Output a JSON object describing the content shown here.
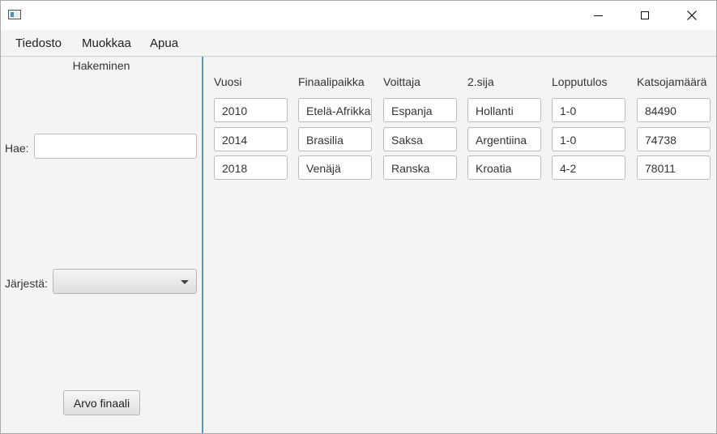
{
  "window": {
    "icon": "app-window-icon",
    "controls": [
      "minimize-icon",
      "maximize-icon",
      "close-icon"
    ]
  },
  "menu": {
    "items": [
      {
        "label": "Tiedosto"
      },
      {
        "label": "Muokkaa"
      },
      {
        "label": "Apua"
      }
    ]
  },
  "left": {
    "title": "Hakeminen",
    "search_label": "Hae:",
    "search_value": "",
    "sort_label": "Järjestä:",
    "sort_value": "",
    "button_label": "Arvo finaali"
  },
  "table": {
    "headers": [
      "Vuosi",
      "Finaalipaikka",
      "Voittaja",
      "2.sija",
      "Lopputulos",
      "Katsojamäärä"
    ],
    "rows": [
      [
        "2010",
        "Etelä-Afrikka",
        "Espanja",
        "Hollanti",
        "1-0",
        "84490"
      ],
      [
        "2014",
        "Brasilia",
        "Saksa",
        "Argentiina",
        "1-0",
        "74738"
      ],
      [
        "2018",
        "Venäjä",
        "Ranska",
        "Kroatia",
        "4-2",
        "78011"
      ]
    ]
  },
  "colors": {
    "divider": "#4f9bc9",
    "panel_background": "#f4f4f4"
  }
}
